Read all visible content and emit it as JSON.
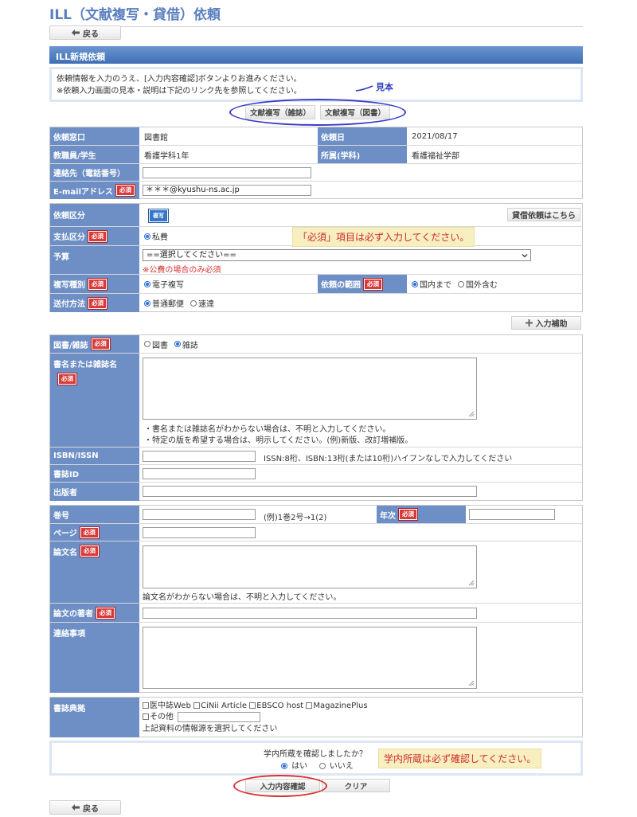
{
  "page": {
    "title": "ILL（文献複写・貸借）依頼"
  },
  "nav": {
    "back_label": "戻る"
  },
  "section": {
    "title": "ILL新規依頼"
  },
  "intro": {
    "line1": "依頼情報を入力のうえ、[入力内容確認]ボタンよりお進みください。",
    "line2": "※依頼入力画面の見本・説明は下記のリンク先を参照してください。"
  },
  "annotation": {
    "mihon": "見本"
  },
  "samples": {
    "journal_label": "文献複写（雑誌）",
    "book_label": "文献複写（図書）"
  },
  "req_label": "必須",
  "requester": {
    "window_label": "依頼窓口",
    "window_value": "図書館",
    "date_label": "依頼日",
    "date_value": "2021/08/17",
    "status_label": "教職員/学生",
    "status_value": "看護学科1年",
    "dept_label": "所属(学科)",
    "dept_value": "看護福祉学部",
    "phone_label": "連絡先（電話番号）",
    "phone_value": "",
    "email_label": "E-mailアドレス",
    "email_value": "＊＊＊@kyushu-ns.ac.jp"
  },
  "request": {
    "type_label": "依頼区分",
    "type_badge": "複写",
    "loan_link": "貸借依頼はこちら",
    "pay_label": "支払区分",
    "pay_option": "私費",
    "callout_required": "「必須」項目は必ず入力してください。",
    "budget_label": "予算",
    "budget_selected": "==選択してください==",
    "budget_note": "※公費の場合のみ必須",
    "copy_label": "複写種別",
    "copy_option": "電子複写",
    "scope_label": "依頼の範囲",
    "scope_opt1": "国内まで",
    "scope_opt2": "国外含む",
    "ship_label": "送付方法",
    "ship_opt1": "普通郵便",
    "ship_opt2": "速達"
  },
  "assist": {
    "label": "入力補助"
  },
  "item": {
    "kind_label": "図書/雑誌",
    "kind_opt1": "図書",
    "kind_opt2": "雑誌",
    "title_label": "書名または雑誌名",
    "title_help1": "・書名または雑誌名がわからない場合は、不明と入力してください。",
    "title_help2": "・特定の版を希望する場合は、明示してください。(例)新版、改訂増補版。",
    "isbn_label": "ISBN/ISSN",
    "isbn_help": "ISSN:8桁、ISBN:13桁(または10桁)ハイフンなしで入力してください",
    "bibid_label": "書誌ID",
    "publisher_label": "出版者"
  },
  "article": {
    "volume_label": "巻号",
    "volume_help": "(例)1巻2号→1(2)",
    "year_label": "年次",
    "page_label": "ページ",
    "title_label": "論文名",
    "title_help": "論文名がわからない場合は、不明と入力してください。",
    "author_label": "論文の著者",
    "notes_label": "連絡事項"
  },
  "source": {
    "label": "書誌典拠",
    "opt1": "医中誌Web",
    "opt2": "CiNii Article",
    "opt3": "EBSCO host",
    "opt4": "MagazinePlus",
    "other": "その他",
    "help": "上記資料の情報源を選択してください"
  },
  "confirm": {
    "question": "学内所蔵を確認しましたか？",
    "yes": "はい",
    "no": "いいえ",
    "callout": "学内所蔵は必ず確認してください。"
  },
  "actions": {
    "confirm_label": "入力内容確認",
    "clear_label": "クリア"
  },
  "colors": {
    "header_blue": "#3e6fb4",
    "label_blue": "#6d8fc6",
    "required_red": "#d83a3a",
    "title_blue": "#5a7fbf"
  }
}
